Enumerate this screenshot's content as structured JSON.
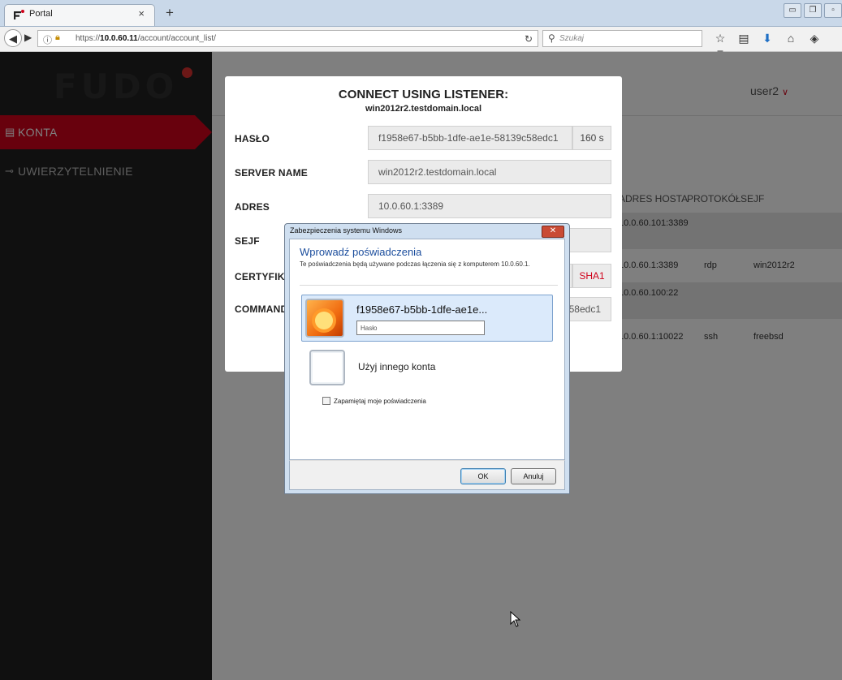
{
  "browser": {
    "tab_title": "Portal",
    "tab_close": "×",
    "new_tab": "+",
    "url_prefix": "https://",
    "url_host": "10.0.60.11",
    "url_path": "/account/account_list/",
    "search_placeholder": "Szukaj"
  },
  "app": {
    "logo_text": "FUDO",
    "user": "user2",
    "sidebar": [
      {
        "label": "KONTA",
        "icon": "book-icon",
        "active": true
      },
      {
        "label": "UWIERZYTELNIENIE",
        "icon": "key-icon",
        "active": false
      }
    ],
    "table": {
      "headers": [
        "ADRES HOSTA",
        "PROTOKÓŁ",
        "SEJF"
      ],
      "rows": [
        {
          "host": "10.0.60.101:3389",
          "protocol": "",
          "vault": ""
        },
        {
          "host": "10.0.60.1:3389",
          "protocol": "rdp",
          "vault": "win2012r2"
        },
        {
          "host": "10.0.60.100:22",
          "protocol": "",
          "vault": ""
        },
        {
          "host": "10.0.60.1:10022",
          "protocol": "ssh",
          "vault": "freebsd"
        }
      ]
    }
  },
  "modal": {
    "title": "CONNECT USING LISTENER:",
    "subtitle": "win2012r2.testdomain.local",
    "fields": {
      "password_label": "HASŁO",
      "password_value": "f1958e67-b5bb-1dfe-ae1e-58139c58edc1",
      "password_ttl": "160 s",
      "server_name_label": "SERVER NAME",
      "server_name_value": "win2012r2.testdomain.local",
      "address_label": "ADRES",
      "address_value": "10.0.60.1:3389",
      "vault_label": "SEJF",
      "vault_value": "",
      "certificate_label": "CERTYFIKAT",
      "certificate_value": "",
      "certificate_algo": "SHA1",
      "command_label": "COMMAND",
      "command_value": "58edc1"
    }
  },
  "windows_dialog": {
    "title": "Zabezpieczenia systemu Windows",
    "close": "✕",
    "heading": "Wprowadź poświadczenia",
    "description": "Te poświadczenia będą używane podczas łączenia się z komputerem 10.0.60.1.",
    "username": "f1958e67-b5bb-1dfe-ae1e...",
    "password_placeholder": "Hasło",
    "other_account": "Użyj innego konta",
    "remember": "Zapamiętaj moje poświadczenia",
    "ok": "OK",
    "cancel": "Anuluj"
  },
  "colors": {
    "accent": "#d0021b",
    "sidebar_bg": "#212121",
    "dialog_heading": "#1a4c9c"
  }
}
